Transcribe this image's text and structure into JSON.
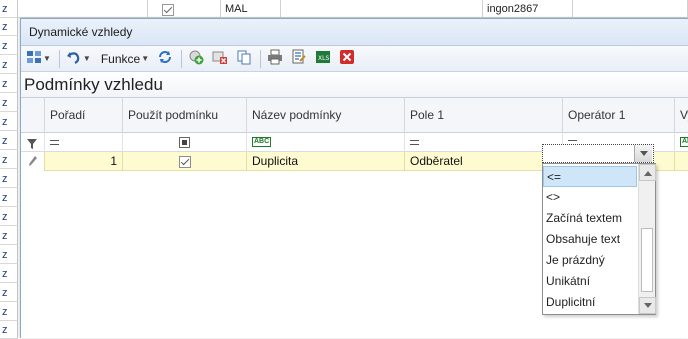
{
  "background": {
    "left_col_values": [
      "z",
      "z",
      "z",
      "z",
      "z",
      "z",
      "z",
      "z",
      "z",
      "z",
      "z",
      "z",
      "z",
      "z",
      "z",
      "z",
      "z",
      "z"
    ],
    "top_row": {
      "code": "MAL",
      "user": "ingon2867"
    }
  },
  "dialog": {
    "title": "Dynamické vzhledy",
    "toolbar": {
      "funkce_label": "Funkce",
      "icons": [
        "layout-icon",
        "undo-icon",
        "refresh-icon",
        "add-icon",
        "delete-icon",
        "copy-icon",
        "print-icon",
        "report-icon",
        "excel-icon",
        "close-red-icon"
      ]
    },
    "section_title": "Podmínky vzhledu",
    "columns": [
      "Pořadí",
      "Použít podmínku",
      "Název podmínky",
      "Pole 1",
      "Operátor 1",
      "Vy"
    ],
    "row": {
      "poradi": "1",
      "pouzit": true,
      "nazev": "Duplicita",
      "pole": "Odběratel",
      "operator": ""
    },
    "dropdown": {
      "options": [
        "<=",
        "<>",
        "Začíná textem",
        "Obsahuje text",
        "Je prázdný",
        "Unikátní",
        "Duplicitní"
      ],
      "selected_index": 0
    }
  },
  "colors": {
    "row_bg": "#fffbd0",
    "accent": "#cfe6f8"
  }
}
